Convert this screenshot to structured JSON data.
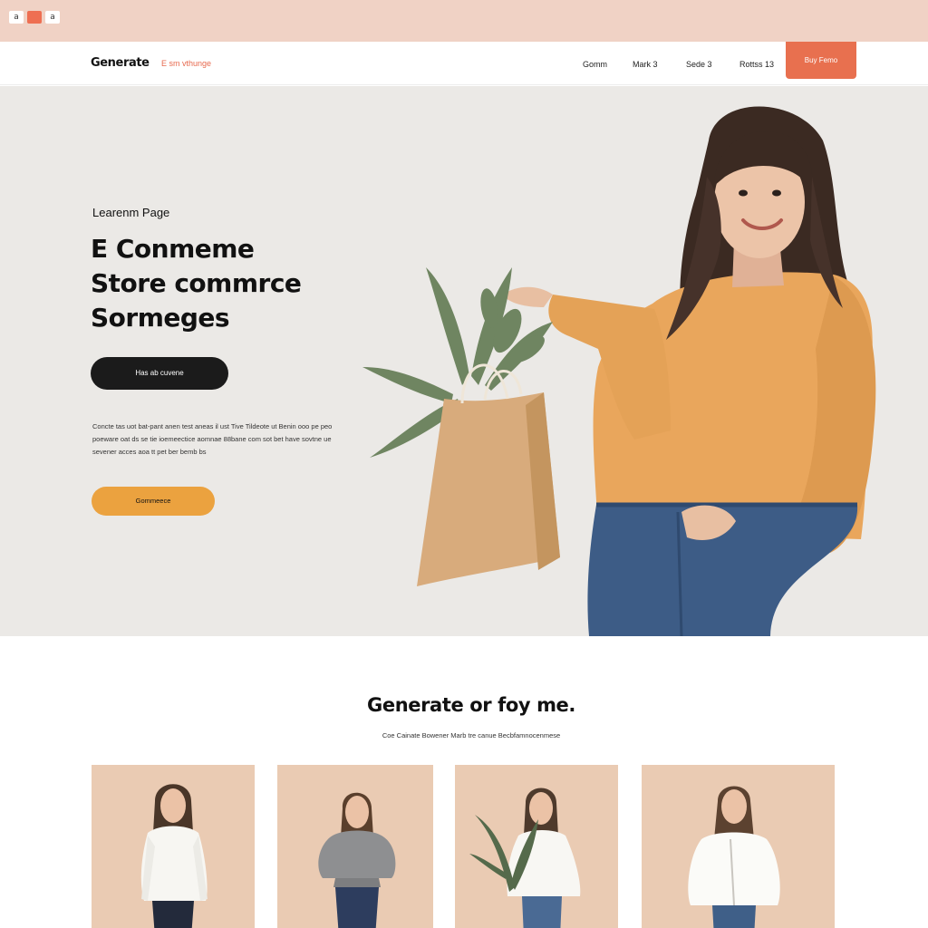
{
  "window": {
    "strip_icons": [
      "a",
      "",
      "a"
    ]
  },
  "nav": {
    "brand": "Generate",
    "brand_tag": "E sm vthunge",
    "links": [
      "Gomm",
      "Mark 3",
      "Sede 3",
      "Rottss 13"
    ],
    "cta": "Buy Femo"
  },
  "hero": {
    "eyebrow": "Learenm Page",
    "title_lines": [
      "E Conmeme",
      "Store commrce",
      "Sormeges"
    ],
    "primary_button": "Has ab cuvene",
    "copy": "Concte tas uot bat-pant anen test aneas il ust Tive Tildeote ut Benin ooo pe peo poeware oat ds se tie ioemeectice aomnae 88bane com sot bet have sovtne ue sevener acces aoa tt pet ber bemb bs",
    "secondary_button": "Gommeece"
  },
  "products": {
    "title": "Generate or foy me.",
    "subtitle": "Coe Cainate Bowener Marb tre canue Becbfamnocenmese",
    "cards": [
      {
        "top": "white-blouse",
        "bottom": "navy-jeans",
        "plant": false
      },
      {
        "top": "grey-sweater",
        "bottom": "navy-jeans",
        "plant": false
      },
      {
        "top": "white-shirt",
        "bottom": "blue-jeans",
        "plant": true
      },
      {
        "top": "white-jacket",
        "bottom": "blue-jeans",
        "plant": false
      }
    ]
  },
  "colors": {
    "strip": "#f0d2c5",
    "accent": "#e8704f",
    "hero_bg": "#ebe9e6",
    "dark_button": "#1b1b1b",
    "yellow_button": "#eba23f",
    "card_bg": "#eacbb3",
    "sweater": "#e9a65c",
    "jeans": "#3d5c86",
    "bag": "#d8ab7c"
  }
}
